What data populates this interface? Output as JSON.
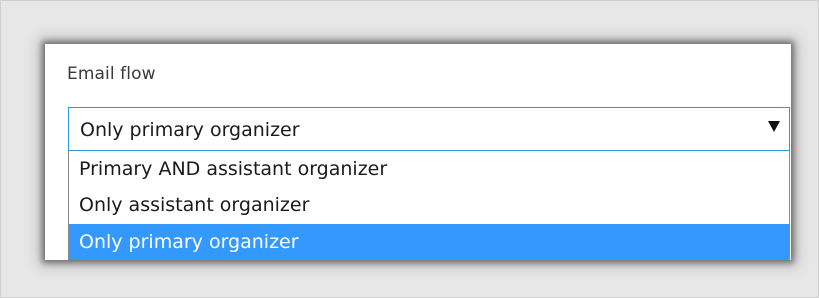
{
  "email_flow": {
    "label": "Email flow",
    "selected_value": "Only primary organizer",
    "options": [
      {
        "label": "Primary AND assistant organizer",
        "selected": false
      },
      {
        "label": "Only assistant organizer",
        "selected": false
      },
      {
        "label": "Only primary organizer",
        "selected": true
      }
    ]
  },
  "colors": {
    "highlight": "#3399ff",
    "focus_border": "#2b9be0",
    "background": "#e7e7e7"
  }
}
